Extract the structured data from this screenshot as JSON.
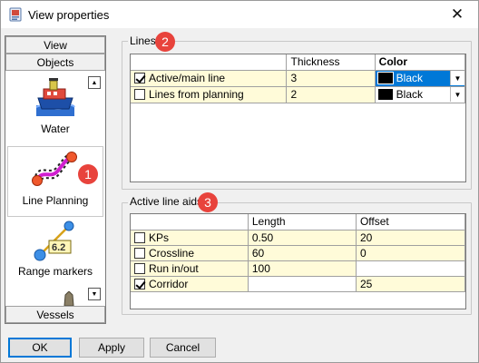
{
  "window": {
    "title": "View properties"
  },
  "nav": {
    "headers": {
      "view": "View",
      "objects": "Objects",
      "vessels": "Vessels"
    },
    "items": [
      {
        "label": "Water",
        "icon": "ship-icon"
      },
      {
        "label": "Line Planning",
        "icon": "line-planning-icon",
        "selected": true
      },
      {
        "label": "Range markers",
        "icon": "range-marker-icon",
        "marker_value": "6.2"
      }
    ]
  },
  "lines_group": {
    "title": "Lines",
    "badge": "2",
    "columns": {
      "name": "",
      "thickness": "Thickness",
      "color": "Color"
    },
    "rows": [
      {
        "name": "Active/main line",
        "checked": true,
        "thickness": "3",
        "color": "Black",
        "color_hex": "#000000"
      },
      {
        "name": "Lines from planning",
        "checked": false,
        "thickness": "2",
        "color": "Black",
        "color_hex": "#000000"
      }
    ]
  },
  "aids_group": {
    "title": "Active line aids",
    "badge": "3",
    "columns": {
      "name": "",
      "length": "Length",
      "offset": "Offset"
    },
    "rows": [
      {
        "name": "KPs",
        "checked": false,
        "length": "0.50",
        "offset": "20"
      },
      {
        "name": "Crossline",
        "checked": false,
        "length": "60",
        "offset": "0"
      },
      {
        "name": "Run in/out",
        "checked": false,
        "length": "100",
        "offset": ""
      },
      {
        "name": "Corridor",
        "checked": true,
        "length": "",
        "offset": "25"
      }
    ]
  },
  "nav_badge": "1",
  "buttons": {
    "ok": "OK",
    "apply": "Apply",
    "cancel": "Cancel"
  },
  "colors": {
    "badge": "#e8433c",
    "selection": "#0078d7",
    "editable_cell": "#fffbd9"
  }
}
